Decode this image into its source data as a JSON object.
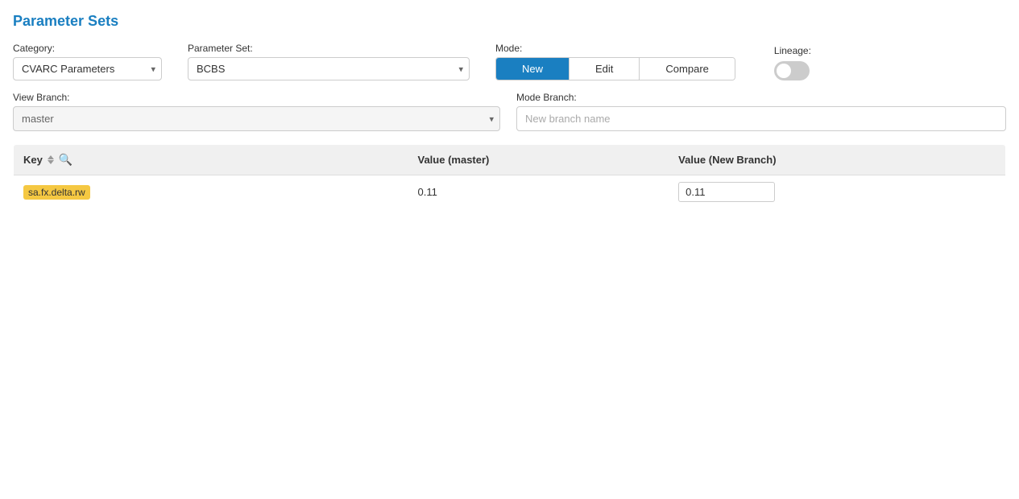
{
  "page": {
    "title": "Parameter Sets"
  },
  "category": {
    "label": "Category:",
    "value": "CVARC Parameters",
    "options": [
      "CVARC Parameters"
    ]
  },
  "parameterSet": {
    "label": "Parameter Set:",
    "value": "BCBS",
    "options": [
      "BCBS"
    ]
  },
  "mode": {
    "label": "Mode:",
    "buttons": [
      {
        "label": "New",
        "active": true
      },
      {
        "label": "Edit",
        "active": false
      },
      {
        "label": "Compare",
        "active": false
      }
    ]
  },
  "lineage": {
    "label": "Lineage:",
    "enabled": false
  },
  "viewBranch": {
    "label": "View Branch:",
    "placeholder": "master",
    "value": "master"
  },
  "modeBranch": {
    "label": "Mode Branch:",
    "placeholder": "New branch name"
  },
  "table": {
    "columns": [
      {
        "id": "key",
        "label": "Key"
      },
      {
        "id": "value_master",
        "label": "Value (master)"
      },
      {
        "id": "value_new",
        "label": "Value (New Branch)"
      }
    ],
    "rows": [
      {
        "key": "sa.fx.delta.rw",
        "value_master": "0.11",
        "value_new": "0.11"
      }
    ]
  }
}
